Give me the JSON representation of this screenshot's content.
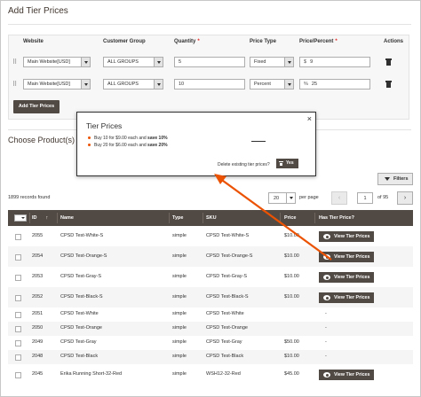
{
  "page": {
    "title": "Add Tier Prices"
  },
  "tier_prices": {
    "headers": {
      "website": "Website",
      "customer_group": "Customer Group",
      "quantity": "Quantity",
      "price_type": "Price Type",
      "price_percent": "Price/Percent",
      "actions": "Actions"
    },
    "required_mark": "*",
    "rows": [
      {
        "website": "Main Website[USD]",
        "customer_group": "ALL GROUPS",
        "quantity": "5",
        "price_type": "Fixed",
        "price_prefix": "$",
        "price_value": "9"
      },
      {
        "website": "Main Website[USD]",
        "customer_group": "ALL GROUPS",
        "quantity": "10",
        "price_type": "Percent",
        "price_prefix": "%",
        "price_value": "25"
      }
    ],
    "add_button": "Add Tier Prices"
  },
  "choose_products": {
    "title": "Choose Product(s)"
  },
  "popup": {
    "title": "Tier Prices",
    "close": "×",
    "lines": [
      {
        "text": "Buy 10 for $9.00 each and ",
        "bold": "save 10%"
      },
      {
        "text": "Buy 20 for $6.00 each and ",
        "bold": "save 20%"
      }
    ],
    "delete_question": "Delete existing tier prices?",
    "yes_button": "Yes"
  },
  "toolbar": {
    "filters": "Filters",
    "records": "1899 records found",
    "per_page_value": "20",
    "per_page_label": "per page",
    "prev": "‹",
    "page_value": "1",
    "of_pages": "of 95",
    "next": "›"
  },
  "grid": {
    "columns": {
      "id": "ID",
      "sort": "↑",
      "name": "Name",
      "type": "Type",
      "sku": "SKU",
      "price": "Price",
      "has_tier": "Has Tier Price?"
    },
    "view_label": "View Tier Prices",
    "rows": [
      {
        "id": "2055",
        "name": "CPSD Test-White-S",
        "type": "simple",
        "sku": "CPSD Test-White-S",
        "price": "$10.00",
        "has_tier": true
      },
      {
        "id": "2054",
        "name": "CPSD Test-Orange-S",
        "type": "simple",
        "sku": "CPSD Test-Orange-S",
        "price": "$10.00",
        "has_tier": true
      },
      {
        "id": "2053",
        "name": "CPSD Test-Gray-S",
        "type": "simple",
        "sku": "CPSD Test-Gray-S",
        "price": "$10.00",
        "has_tier": true
      },
      {
        "id": "2052",
        "name": "CPSD Test-Black-S",
        "type": "simple",
        "sku": "CPSD Test-Black-S",
        "price": "$10.00",
        "has_tier": true
      },
      {
        "id": "2051",
        "name": "CPSD Test-White",
        "type": "simple",
        "sku": "CPSD Test-White",
        "price": "",
        "has_tier": false,
        "tier_text": "-"
      },
      {
        "id": "2050",
        "name": "CPSD Test-Orange",
        "type": "simple",
        "sku": "CPSD Test-Orange",
        "price": "",
        "has_tier": false,
        "tier_text": "-"
      },
      {
        "id": "2049",
        "name": "CPSD Test-Gray",
        "type": "simple",
        "sku": "CPSD Test-Gray",
        "price": "$50.00",
        "has_tier": false,
        "tier_text": "-"
      },
      {
        "id": "2048",
        "name": "CPSD Test-Black",
        "type": "simple",
        "sku": "CPSD Test-Black",
        "price": "$10.00",
        "has_tier": false,
        "tier_text": "-"
      },
      {
        "id": "2045",
        "name": "Erika Running Short-32-Red",
        "type": "simple",
        "sku": "WSH12-32-Red",
        "price": "$45.00",
        "has_tier": true
      }
    ]
  },
  "colors": {
    "accent": "#eb5202",
    "button_dark": "#514943",
    "header_bg": "#514943"
  }
}
